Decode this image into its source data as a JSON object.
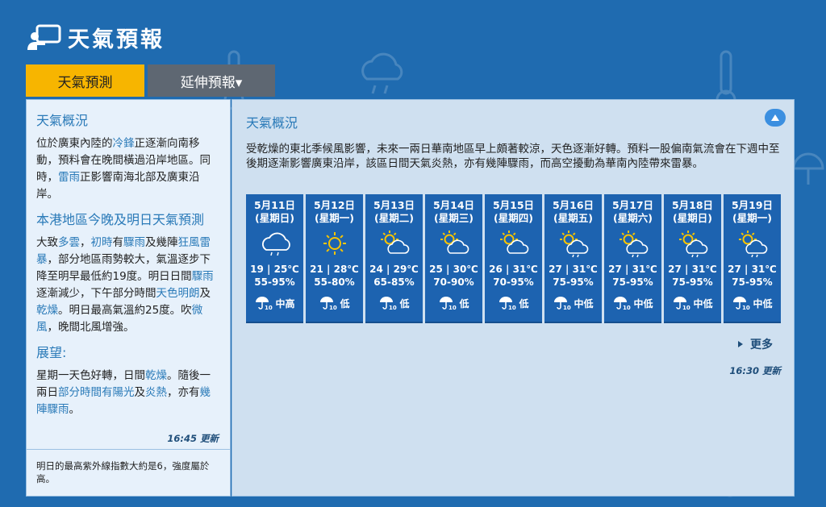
{
  "header": {
    "title": "天氣預報"
  },
  "tabs": [
    {
      "label": "天氣預測",
      "active": true
    },
    {
      "label": "延伸預報▾",
      "active": false
    }
  ],
  "left": {
    "heading1": "天氣概況",
    "p1": [
      {
        "t": "位於廣東內陸的"
      },
      {
        "t": "冷鋒",
        "k": true
      },
      {
        "t": "正逐漸向南移動，預料會在晚間橫過沿岸地區。同時，"
      },
      {
        "t": "雷雨",
        "k": true
      },
      {
        "t": "正影響南海北部及廣東沿岸。"
      }
    ],
    "heading2": "本港地區今晚及明日天氣預測",
    "p2": [
      {
        "t": "大致"
      },
      {
        "t": "多雲",
        "k": true
      },
      {
        "t": "，"
      },
      {
        "t": "初時",
        "k": true
      },
      {
        "t": "有"
      },
      {
        "t": "驟雨",
        "k": true
      },
      {
        "t": "及幾陣"
      },
      {
        "t": "狂風雷暴",
        "k": true
      },
      {
        "t": "，部分地區雨勢較大，氣溫逐步下降至明早最低約19度。明日日間"
      },
      {
        "t": "驟雨",
        "k": true
      },
      {
        "t": "逐漸減少，下午部分時間"
      },
      {
        "t": "天色明朗",
        "k": true
      },
      {
        "t": "及"
      },
      {
        "t": "乾燥",
        "k": true
      },
      {
        "t": "。明日最高氣溫約25度。吹"
      },
      {
        "t": "微風",
        "k": true
      },
      {
        "t": "，晚間北風增強。"
      }
    ],
    "heading3": "展望:",
    "p3": [
      {
        "t": "星期一天色好轉，日間"
      },
      {
        "t": "乾燥",
        "k": true
      },
      {
        "t": "。隨後一兩日"
      },
      {
        "t": "部分時間有陽光",
        "k": true
      },
      {
        "t": "及"
      },
      {
        "t": "炎熱",
        "k": true
      },
      {
        "t": "，亦有"
      },
      {
        "t": "幾陣驟雨",
        "k": true
      },
      {
        "t": "。"
      }
    ],
    "update": "16:45 更新",
    "uv": "明日的最高紫外線指數大約是6，強度屬於高。"
  },
  "right": {
    "heading": "天氣概況",
    "text": "受乾燥的東北季候風影響，未來一兩日華南地區早上頗著較涼，天色逐漸好轉。預料一股偏南氣流會在下週中至後期逐漸影響廣東沿岸，該區日間天氣炎熱，亦有幾陣驟雨，而高空擾動為華南內陸帶來雷暴。",
    "more": "更多",
    "update": "16:30 更新",
    "forecast": [
      {
        "date": "5月11日",
        "dow": "(星期日)",
        "icon": "cloud-rain-icon",
        "temp": "19 | 25℃",
        "hum": "55-95%",
        "psr": "中高"
      },
      {
        "date": "5月12日",
        "dow": "(星期一)",
        "icon": "sunny-icon",
        "temp": "21 | 28℃",
        "hum": "55-80%",
        "psr": "低"
      },
      {
        "date": "5月13日",
        "dow": "(星期二)",
        "icon": "sun-cloud-icon",
        "temp": "24 | 29℃",
        "hum": "65-85%",
        "psr": "低"
      },
      {
        "date": "5月14日",
        "dow": "(星期三)",
        "icon": "sun-cloud-icon",
        "temp": "25 | 30℃",
        "hum": "70-90%",
        "psr": "低"
      },
      {
        "date": "5月15日",
        "dow": "(星期四)",
        "icon": "sun-cloud-icon",
        "temp": "26 | 31℃",
        "hum": "70-95%",
        "psr": "低"
      },
      {
        "date": "5月16日",
        "dow": "(星期五)",
        "icon": "sun-shower-icon",
        "temp": "27 | 31℃",
        "hum": "75-95%",
        "psr": "中低"
      },
      {
        "date": "5月17日",
        "dow": "(星期六)",
        "icon": "sun-shower-icon",
        "temp": "27 | 31℃",
        "hum": "75-95%",
        "psr": "中低"
      },
      {
        "date": "5月18日",
        "dow": "(星期日)",
        "icon": "sun-shower-icon",
        "temp": "27 | 31℃",
        "hum": "75-95%",
        "psr": "中低"
      },
      {
        "date": "5月19日",
        "dow": "(星期一)",
        "icon": "sun-shower-icon",
        "temp": "27 | 31℃",
        "hum": "75-95%",
        "psr": "中低"
      }
    ]
  }
}
